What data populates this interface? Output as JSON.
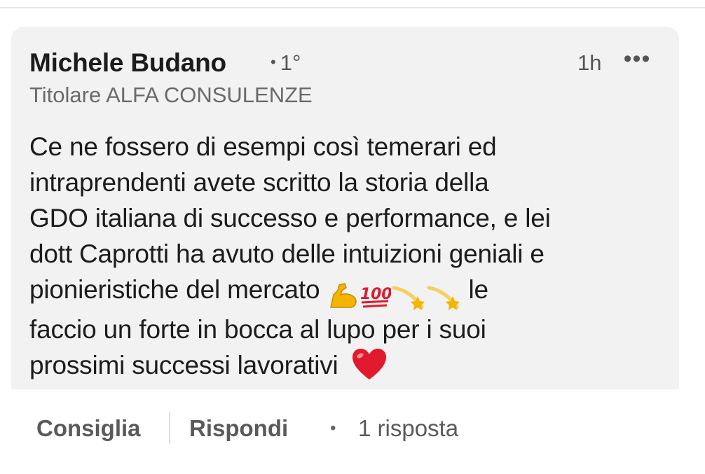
{
  "comment": {
    "author_name": "Michele Budano",
    "degree": "1°",
    "degree_separator": "•",
    "timestamp": "1h",
    "more_label": "•••",
    "headline": "Titolare ALFA CONSULENZE",
    "text_part1": "Ce ne fossero di esempi così temerari ed\nintraprendenti   avete scritto la storia della\nGDO italiana di successo e performance, e lei\ndott Caprotti ha avuto delle intuizioni geniali e\npionieristiche del mercato ",
    "text_part2": " le\nfaccio un forte in bocca al lupo per i  suoi\nprossimi successi lavorativi ",
    "emojis": [
      "flexed-biceps",
      "hundred-points",
      "dizzy",
      "dizzy"
    ],
    "end_emoji": "red-heart"
  },
  "actions": {
    "like_label": "Consiglia",
    "reply_label": "Rispondi",
    "replies_separator": "•",
    "replies_count": "1 risposta"
  },
  "colors": {
    "bubble_bg": "#f2f2f2",
    "text": "#1c1c1c",
    "muted": "#6a6a6a",
    "heart": "#e0192e",
    "emoji_gold": "#f4b400"
  }
}
